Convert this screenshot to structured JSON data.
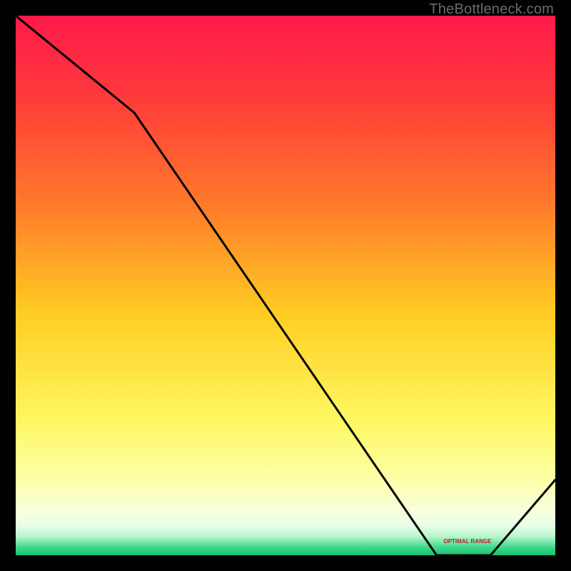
{
  "watermark": "TheBottleneck.com",
  "optimal_label": "OPTIMAL RANGE",
  "chart_data": {
    "type": "line",
    "title": "",
    "xlabel": "",
    "ylabel": "",
    "ylim": [
      0,
      100
    ],
    "x": [
      0,
      22,
      78,
      88,
      100
    ],
    "values": [
      100,
      82,
      0,
      0,
      14
    ],
    "gradient_stops": [
      {
        "pos": 0.0,
        "color": "#ff1a4b"
      },
      {
        "pos": 0.15,
        "color": "#ff3a3a"
      },
      {
        "pos": 0.35,
        "color": "#ff7a2a"
      },
      {
        "pos": 0.55,
        "color": "#ffcc22"
      },
      {
        "pos": 0.75,
        "color": "#fff860"
      },
      {
        "pos": 0.86,
        "color": "#fdffa8"
      },
      {
        "pos": 0.92,
        "color": "#f8ffe0"
      },
      {
        "pos": 0.945,
        "color": "#e8ffe8"
      },
      {
        "pos": 0.965,
        "color": "#b7f6cd"
      },
      {
        "pos": 0.985,
        "color": "#3fd98b"
      },
      {
        "pos": 1.0,
        "color": "#16c073"
      }
    ],
    "optimal_range_x": [
      78,
      88
    ]
  }
}
